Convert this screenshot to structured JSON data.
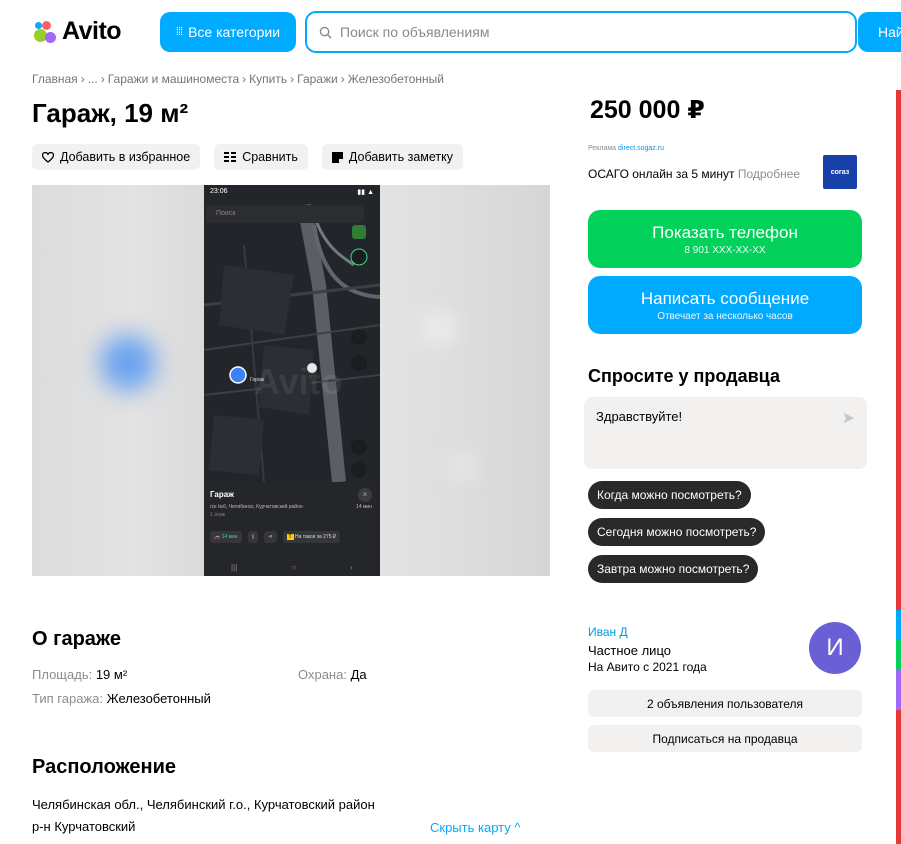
{
  "header": {
    "logo_text": "Avito",
    "categories_label": "Все категории",
    "search_placeholder": "Поиск по объявлениям",
    "find_label": "Найти",
    "accent_color": "#00aaff"
  },
  "breadcrumb": [
    "Главная",
    "...",
    "Гаражи и машиноместа",
    "Купить",
    "Гаражи",
    "Железобетонный"
  ],
  "title": "Гараж, 19 м²",
  "actions": {
    "favorite": "Добавить в избранное",
    "compare": "Сравнить",
    "note": "Добавить заметку"
  },
  "screenshot_phone": {
    "time": "23:06",
    "search": "Поиск",
    "place_label": "Гараж",
    "card_title": "Гараж",
    "address": "гск №6, Челябинск, Курчатовский район",
    "duration": "14 мин",
    "floor": "1 этаж",
    "drive_time": "14 мин",
    "taxi": "На такси за 275 ₽",
    "watermark": "Avito"
  },
  "about": {
    "heading": "О гараже",
    "params": [
      {
        "label": "Площадь:",
        "value": "19 м²"
      },
      {
        "label": "Охрана:",
        "value": "Да"
      },
      {
        "label": "Тип гаража:",
        "value": "Железобетонный"
      }
    ]
  },
  "location": {
    "heading": "Расположение",
    "address_line1": "Челябинская обл., Челябинский г.о., Курчатовский район",
    "address_line2": "р-н Курчатовский",
    "hide_map": "Скрыть карту ^"
  },
  "sidebar": {
    "price": "250 000 ₽",
    "ad": {
      "label": "Реклама",
      "link": "direct.sogaz.ru",
      "text": "ОСАГО онлайн за 5 минут",
      "more": "Подробнее",
      "brand": "согаз"
    },
    "phone_button": {
      "label": "Показать телефон",
      "sub": "8 901 XXX-XX-XX",
      "color": "#02d15c"
    },
    "message_button": {
      "label": "Написать сообщение",
      "sub": "Отвечает за несколько часов",
      "color": "#00aaff"
    },
    "ask": {
      "heading": "Спросите у продавца",
      "placeholder": "Здравствуйте!",
      "chips": [
        "Когда можно посмотреть?",
        "Сегодня можно посмотреть?",
        "Завтра можно посмотреть?"
      ]
    },
    "seller": {
      "name": "Иван Д",
      "type": "Частное лицо",
      "since": "На Авито с 2021 года",
      "avatar_letter": "И",
      "ads_button": "2 объявления пользователя",
      "subscribe_button": "Подписаться на продавца"
    }
  }
}
